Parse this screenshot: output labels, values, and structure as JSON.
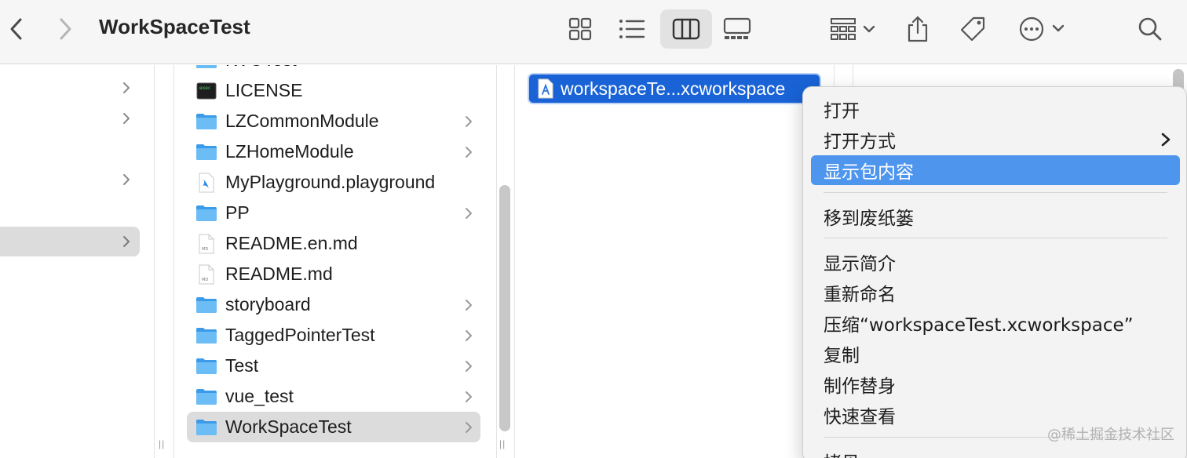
{
  "window": {
    "title": "WorkSpaceTest"
  },
  "toolbar": {
    "buttons": [
      {
        "name": "back",
        "icon": "chevron-left-icon"
      },
      {
        "name": "forward",
        "icon": "chevron-right-icon"
      },
      {
        "name": "icon-view",
        "icon": "grid-icon"
      },
      {
        "name": "list-view",
        "icon": "list-icon"
      },
      {
        "name": "column-view",
        "icon": "columns-icon",
        "active": true
      },
      {
        "name": "gallery-view",
        "icon": "gallery-icon"
      },
      {
        "name": "group",
        "icon": "group-icon"
      },
      {
        "name": "share",
        "icon": "share-icon"
      },
      {
        "name": "tag",
        "icon": "tag-icon"
      },
      {
        "name": "more",
        "icon": "ellipsis-circle-icon"
      },
      {
        "name": "search",
        "icon": "magnifier-icon"
      }
    ]
  },
  "column2": {
    "items": [
      {
        "name": "KVOTest",
        "type": "folder",
        "has_children": false
      },
      {
        "name": "LICENSE",
        "type": "exec",
        "has_children": false
      },
      {
        "name": "LZCommonModule",
        "type": "folder",
        "has_children": true
      },
      {
        "name": "LZHomeModule",
        "type": "folder",
        "has_children": true
      },
      {
        "name": "MyPlayground.playground",
        "type": "playground",
        "has_children": false
      },
      {
        "name": "PP",
        "type": "folder",
        "has_children": true
      },
      {
        "name": "README.en.md",
        "type": "doc",
        "has_children": false
      },
      {
        "name": "README.md",
        "type": "doc",
        "has_children": false
      },
      {
        "name": "storyboard",
        "type": "folder",
        "has_children": true
      },
      {
        "name": "TaggedPointerTest",
        "type": "folder",
        "has_children": true
      },
      {
        "name": "Test",
        "type": "folder",
        "has_children": true
      },
      {
        "name": "vue_test",
        "type": "folder",
        "has_children": true
      },
      {
        "name": "WorkSpaceTest",
        "type": "folder",
        "has_children": true,
        "selected": true
      }
    ]
  },
  "column3": {
    "selected_file": "workspaceTe...xcworkspace"
  },
  "context_menu": {
    "items": [
      {
        "label": "打开",
        "has_submenu": false
      },
      {
        "label": "打开方式",
        "has_submenu": true
      },
      {
        "label": "显示包内容",
        "highlighted": true
      },
      {
        "label": "移到废纸篓"
      },
      {
        "label": "显示简介"
      },
      {
        "label": "重新命名"
      },
      {
        "label": "压缩“workspaceTest.xcworkspace”"
      },
      {
        "label": "复制"
      },
      {
        "label": "制作替身"
      },
      {
        "label": "快速查看"
      },
      {
        "label": "拷贝"
      }
    ]
  },
  "watermark": "@稀土掘金技术社区",
  "colors": {
    "accent": "#1963d6",
    "highlight": "#4e95ee",
    "folder": "#52a9f0"
  }
}
